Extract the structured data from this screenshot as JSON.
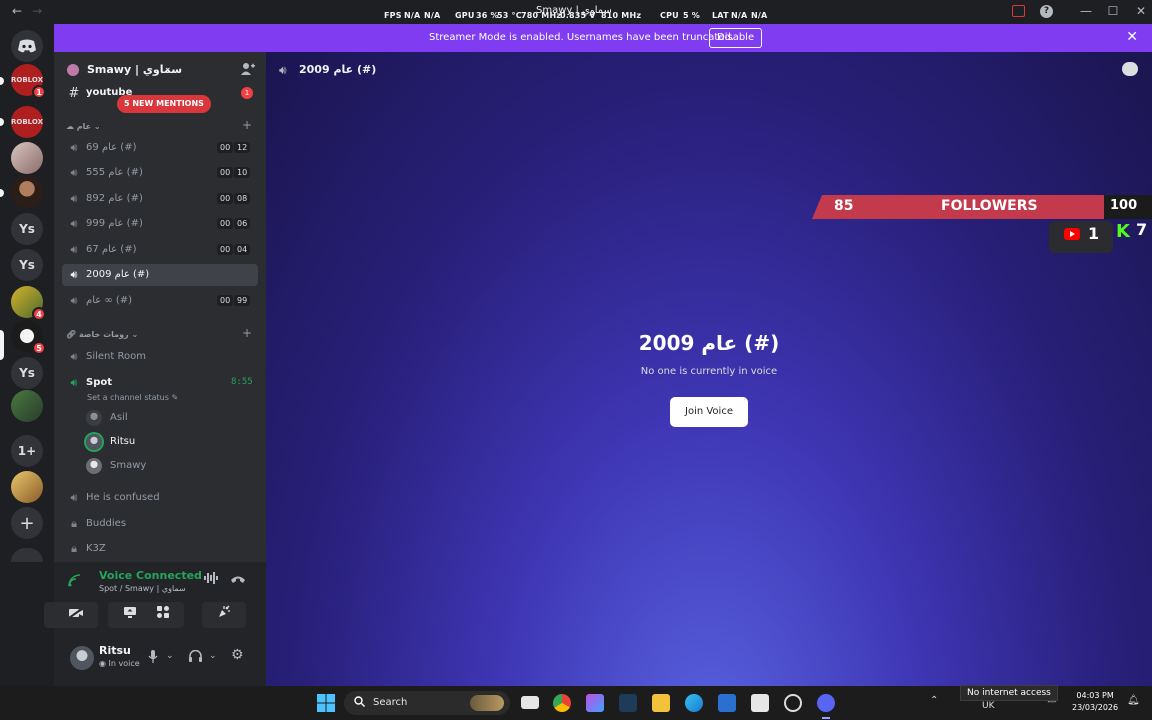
{
  "titlebar": {
    "perf": {
      "fps_label": "FPS",
      "fps_value": "N/A",
      "fps_extra": "N/A",
      "gpu_label": "GPU",
      "gpu_usage": "36 %",
      "gpu_temp": "53 °C",
      "gpu_clock": "780 MHz",
      "gpu_volt": "0.835 V",
      "gpu_mem_clock": "810 MHz",
      "cpu_label": "CPU",
      "cpu_usage": "5 %",
      "lat_label": "LAT",
      "lat_value": "N/A",
      "lat_extra": "N/A"
    },
    "window_title": "Smawy | سماوي",
    "back_glyph": "←",
    "forward_glyph": "→",
    "minimize_glyph": "—",
    "maximize_glyph": "☐",
    "close_glyph": "✕"
  },
  "rail": {
    "home_icon": "discord-logo-icon",
    "servers": [
      {
        "label": "",
        "badge": "1"
      },
      {
        "label": "",
        "badge": ""
      },
      {
        "label": "",
        "badge": ""
      },
      {
        "label": "",
        "badge": ""
      },
      {
        "label": "Ys",
        "badge": ""
      },
      {
        "label": "Ys",
        "badge": ""
      },
      {
        "label": "",
        "badge": "4"
      },
      {
        "label": "",
        "badge": "5"
      },
      {
        "label": "Ys",
        "badge": ""
      },
      {
        "label": "",
        "badge": ""
      },
      {
        "label": "1+",
        "badge": ""
      },
      {
        "label": "",
        "badge": ""
      }
    ],
    "add_server_glyph": "+"
  },
  "banner": {
    "text": "Streamer Mode is enabled. Usernames have been truncated.",
    "button": "Disable",
    "close_glyph": "✕"
  },
  "guild": {
    "name": "Smawy | سماوي",
    "chevron": "⌄"
  },
  "channels_top": {
    "youtube": "youtube",
    "mentions": "5 NEW MENTIONS",
    "unread": "1"
  },
  "category_general": "عام",
  "voice_channels": [
    {
      "name": "عام 69 (#)",
      "c1": "00",
      "c2": "12"
    },
    {
      "name": "عام 555 (#)",
      "c1": "00",
      "c2": "10"
    },
    {
      "name": "عام 892 (#)",
      "c1": "00",
      "c2": "08"
    },
    {
      "name": "عام 999 (#)",
      "c1": "00",
      "c2": "06"
    },
    {
      "name": "عام 67 (#)",
      "c1": "00",
      "c2": "04"
    },
    {
      "name": "عام 2009 (#)",
      "c1": "",
      "c2": ""
    },
    {
      "name": "عام ∞ (#)",
      "c1": "00",
      "c2": "99"
    }
  ],
  "category_private": "رومات خاصة",
  "private_channels": {
    "silent_room": "Silent Room",
    "spot": "Spot",
    "spot_status": "Set a channel status",
    "spot_timer": "8:55",
    "spot_users": [
      "Asil",
      "Ritsu",
      "Smawy"
    ],
    "he_is_confused": "He is confused",
    "buddies": "Buddies",
    "k3z": "K3Z"
  },
  "voice_panel": {
    "status": "Voice Connected",
    "location": "Spot / Smawy | سماوي"
  },
  "user_panel": {
    "name": "Ritsu",
    "status": "In voice"
  },
  "stage": {
    "header": "عام 2009 (#)",
    "title": "عام 2009 (#)",
    "subtitle": "No one is currently in voice",
    "join": "Join Voice"
  },
  "overlay": {
    "followers_count": "85",
    "followers_label": "FOLLOWERS",
    "goal": "100",
    "youtube_count": "1",
    "kick_count": "7"
  },
  "taskbar": {
    "search": "Search",
    "tooltip": "No internet access",
    "lang": "UK",
    "time": "04:03 PM",
    "date": "23/03/2026"
  }
}
